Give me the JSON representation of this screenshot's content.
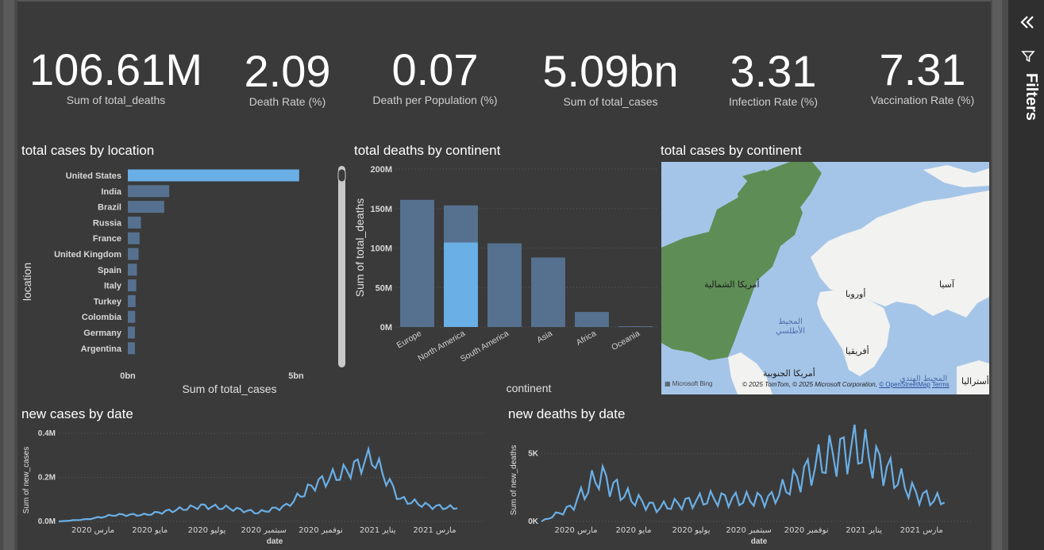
{
  "sidebar": {
    "label": "Filters",
    "collapse_icon": "double-chevron-left-icon",
    "filter_icon": "funnel-icon"
  },
  "kpis": [
    {
      "value": "106.61M",
      "label": "Sum of total_deaths"
    },
    {
      "value": "2.09",
      "label": "Death Rate (%)"
    },
    {
      "value": "0.07",
      "label": "Death per Population (%)"
    },
    {
      "value": "5.09bn",
      "label": "Sum of total_cases"
    },
    {
      "value": "3.31",
      "label": "Infection Rate (%)"
    },
    {
      "value": "7.31",
      "label": "Vaccination Rate (%)"
    }
  ],
  "visuals": {
    "cases_by_location": {
      "title": "total cases by location",
      "ylabel": "location",
      "xlabel": "Sum of total_cases",
      "ticks": [
        "0bn",
        "5bn"
      ]
    },
    "deaths_by_continent": {
      "title": "total deaths by continent",
      "ylabel": "Sum of total_deaths",
      "xlabel": "continent",
      "ticks": [
        "0M",
        "50M",
        "100M",
        "150M",
        "200M"
      ]
    },
    "cases_by_continent_map": {
      "title": "total cases by continent",
      "labels": [
        "أمريكا الشمالية",
        "أوروبا",
        "آسيا",
        "أفريقيا",
        "أمريكا الجنوبية",
        "أستراليا"
      ],
      "ocean": [
        "المحيط",
        "الأطلسي"
      ],
      "ocean2": "المحيط الهندي",
      "brand": "Microsoft Bing",
      "credit": "© 2025 TomTom, © 2025 Microsoft Corporation,",
      "credit_link": "© OpenStreetMap",
      "terms": "Terms"
    },
    "new_cases_by_date": {
      "title": "new cases by date",
      "ylabel": "Sum of new_cases",
      "xlabel": "date",
      "yticks": [
        "0.0M",
        "0.2M",
        "0.4M"
      ]
    },
    "new_deaths_by_date": {
      "title": "new deaths by date",
      "ylabel": "Sum of new_deaths",
      "xlabel": "date",
      "yticks": [
        "0K",
        "5K"
      ]
    },
    "date_ticks": [
      "مارس 2020",
      "مايو 2020",
      "يوليو 2020",
      "سبتمبر 2020",
      "نوفمبر 2020",
      "يناير 2021",
      "مارس 2021"
    ]
  },
  "colors": {
    "bar": "#56718f",
    "highlight": "#6aafe6",
    "line": "#6aafe6",
    "land": "#f2f2f0",
    "na": "#5e8e55",
    "sea": "#a5c5e8"
  },
  "chart_data": [
    {
      "type": "bar",
      "orientation": "horizontal",
      "title": "total cases by location",
      "xlabel": "Sum of total_cases",
      "ylabel": "location",
      "categories": [
        "United States",
        "India",
        "Brazil",
        "Russia",
        "France",
        "United Kingdom",
        "Spain",
        "Italy",
        "Turkey",
        "Colombia",
        "Germany",
        "Argentina"
      ],
      "values": [
        5.09,
        1.23,
        1.08,
        0.39,
        0.35,
        0.32,
        0.27,
        0.25,
        0.23,
        0.22,
        0.21,
        0.21
      ],
      "unit": "bn",
      "xlim": [
        0,
        5.4
      ],
      "highlight": "United States"
    },
    {
      "type": "bar",
      "title": "total deaths by continent",
      "xlabel": "continent",
      "ylabel": "Sum of total_deaths",
      "categories": [
        "Europe",
        "North America",
        "South America",
        "Asia",
        "Africa",
        "Oceania"
      ],
      "values": [
        161,
        154,
        106,
        88,
        19,
        1
      ],
      "highlight_values": [
        0,
        107,
        0,
        0,
        0,
        0
      ],
      "unit": "M",
      "ylim": [
        0,
        200
      ]
    },
    {
      "type": "line",
      "title": "new cases by date",
      "xlabel": "date",
      "ylabel": "Sum of new_cases",
      "unit": "M",
      "ylim": [
        0,
        0.4
      ],
      "x": [
        "2020-02",
        "2020-03",
        "2020-04",
        "2020-05",
        "2020-06",
        "2020-07",
        "2020-08",
        "2020-09",
        "2020-10",
        "2020-11",
        "2020-12",
        "2021-01",
        "2021-02",
        "2021-03",
        "2021-04"
      ],
      "values": [
        0.0,
        0.01,
        0.03,
        0.03,
        0.05,
        0.07,
        0.06,
        0.04,
        0.07,
        0.17,
        0.22,
        0.29,
        0.1,
        0.07,
        0.06
      ]
    },
    {
      "type": "line",
      "title": "new deaths by date",
      "xlabel": "date",
      "ylabel": "Sum of new_deaths",
      "unit": "K",
      "ylim": [
        0,
        6.5
      ],
      "x": [
        "2020-02",
        "2020-03",
        "2020-04",
        "2020-05",
        "2020-06",
        "2020-07",
        "2020-08",
        "2020-09",
        "2020-10",
        "2020-11",
        "2020-12",
        "2021-01",
        "2021-02",
        "2021-03",
        "2021-04"
      ],
      "values": [
        0.0,
        1.0,
        3.4,
        1.8,
        1.0,
        1.4,
        1.7,
        1.6,
        1.7,
        3.3,
        4.8,
        5.5,
        3.8,
        2.0,
        1.4
      ]
    }
  ]
}
